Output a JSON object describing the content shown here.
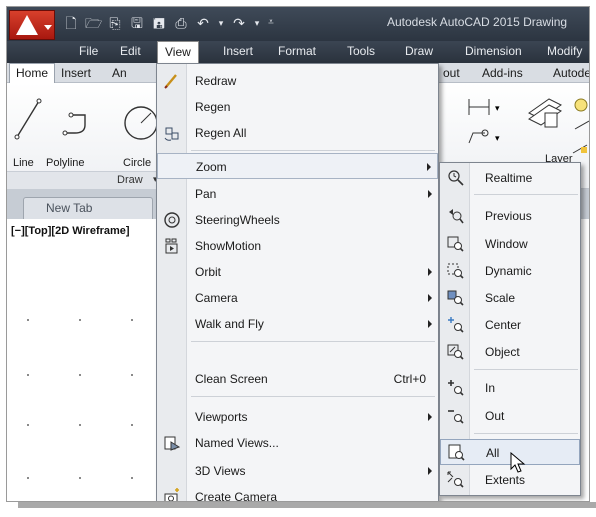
{
  "title_bar": {
    "app_title": "Autodesk AutoCAD 2015   Drawing"
  },
  "menubar": {
    "items": [
      "File",
      "Edit",
      "View",
      "Insert",
      "Format",
      "Tools",
      "Draw",
      "Dimension",
      "Modify"
    ]
  },
  "ribbon_tabs": {
    "items": [
      "Home",
      "Insert",
      "An",
      "out",
      "Add-ins",
      "Autode"
    ]
  },
  "ribbon": {
    "tools": [
      "Line",
      "Polyline",
      "Circle"
    ],
    "layer_label": "Layer",
    "panel_title": "Draw"
  },
  "file_tabs": {
    "new_tab": "New Tab"
  },
  "canvas": {
    "viewport_label": "[−][Top][2D Wireframe]"
  },
  "view_menu": {
    "items": [
      {
        "label": "Redraw",
        "icon": "redraw-icon"
      },
      {
        "label": "Regen"
      },
      {
        "label": "Regen All",
        "icon": "regen-all-icon"
      },
      {
        "label": "Zoom",
        "submenu": true
      },
      {
        "label": "Pan",
        "submenu": true
      },
      {
        "label": "SteeringWheels",
        "icon": "steeringwheels-icon"
      },
      {
        "label": "ShowMotion",
        "icon": "showmotion-icon"
      },
      {
        "label": "Orbit",
        "submenu": true
      },
      {
        "label": "Camera",
        "submenu": true
      },
      {
        "label": "Walk and Fly",
        "submenu": true
      },
      {
        "label": "Clean Screen",
        "shortcut": "Ctrl+0"
      },
      {
        "label": "Viewports",
        "submenu": true
      },
      {
        "label": "Named Views...",
        "icon": "named-views-icon"
      },
      {
        "label": "3D Views",
        "submenu": true
      },
      {
        "label": "Create Camera",
        "icon": "create-camera-icon"
      }
    ]
  },
  "zoom_menu": {
    "items": [
      {
        "label": "Realtime",
        "icon": "zoom-realtime-icon"
      },
      {
        "label": "Previous",
        "icon": "zoom-previous-icon"
      },
      {
        "label": "Window",
        "icon": "zoom-window-icon"
      },
      {
        "label": "Dynamic",
        "icon": "zoom-dynamic-icon"
      },
      {
        "label": "Scale",
        "icon": "zoom-scale-icon"
      },
      {
        "label": "Center",
        "icon": "zoom-center-icon"
      },
      {
        "label": "Object",
        "icon": "zoom-object-icon"
      },
      {
        "label": "In",
        "icon": "zoom-in-icon"
      },
      {
        "label": "Out",
        "icon": "zoom-out-icon"
      },
      {
        "label": "All",
        "icon": "zoom-all-icon",
        "highlighted": true
      },
      {
        "label": "Extents",
        "icon": "zoom-extents-icon"
      }
    ]
  },
  "colors": {
    "title_bar": "#2c3541",
    "logo_red": "#c62a1b",
    "menu_bg": "#f4f5f7",
    "highlight": "#e6ecf5"
  }
}
